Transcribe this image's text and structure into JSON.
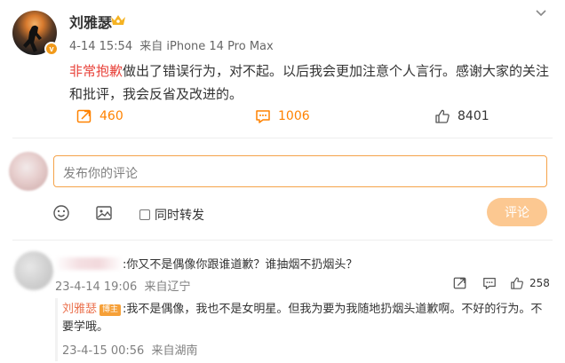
{
  "post": {
    "author": "刘雅瑟",
    "date": "4-14 15:54",
    "source": "来自 iPhone 14 Pro Max",
    "text_highlight": "非常抱歉",
    "text_rest": "做出了错误行为，对不起。以后我会更加注意个人言行。感谢大家的关注和批评，我会反省及改进的。",
    "shares": "460",
    "comments": "1006",
    "likes": "8401",
    "accent_color": "#ff8200",
    "highlight_color": "#e8423a"
  },
  "composer": {
    "placeholder": "发布你的评论",
    "repost_label": "同时转发",
    "submit_label": "评论",
    "border_color": "#f5a34a",
    "button_color": "#fcc891"
  },
  "comment": {
    "text": ":你又不是偶像你跟谁道歉？谁抽烟不扔烟头？",
    "date": "23-4-14 19:06",
    "location": "来自辽宁",
    "likes": "258"
  },
  "reply": {
    "author": "刘雅瑟",
    "badge": "博主",
    "text": ":我不是偶像，我也不是女明星。但我为要为我随地扔烟头道歉啊。不好的行为。不要学哦。",
    "date": "23-4-15 00:56",
    "location": "来自湖南",
    "name_color": "#eb7350"
  },
  "icons": [
    "v-badge-icon",
    "crown-icon",
    "chevron-down-icon",
    "share-icon",
    "comment-icon",
    "like-icon",
    "emoji-icon",
    "image-icon"
  ]
}
